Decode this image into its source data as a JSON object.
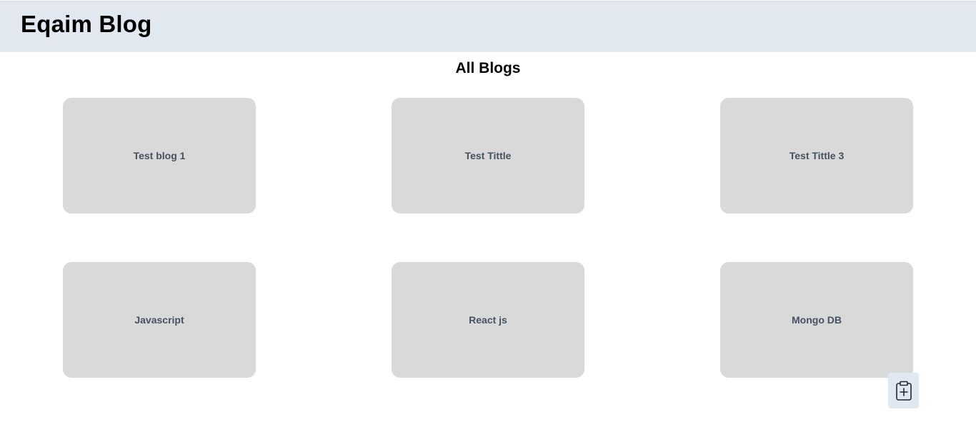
{
  "header": {
    "brand": "Eqaim Blog"
  },
  "main": {
    "heading": "All Blogs",
    "blogs": [
      {
        "title": "Test blog 1"
      },
      {
        "title": "Test Tittle"
      },
      {
        "title": "Test Tittle 3"
      },
      {
        "title": "Javascript"
      },
      {
        "title": "React js"
      },
      {
        "title": "Mongo DB"
      }
    ]
  },
  "add_button": {
    "icon": "clipboard-plus-icon"
  }
}
